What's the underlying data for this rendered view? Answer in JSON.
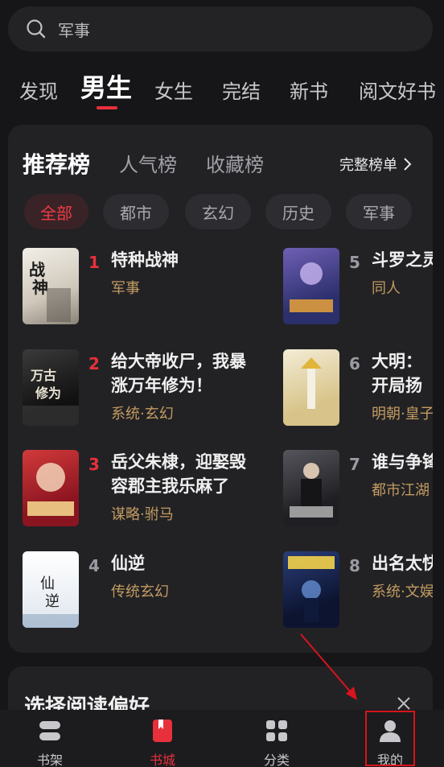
{
  "search": {
    "placeholder_value": "军事",
    "icon": "search-icon"
  },
  "tabs": [
    {
      "label": "发现",
      "active": false
    },
    {
      "label": "男生",
      "active": true
    },
    {
      "label": "女生",
      "active": false
    },
    {
      "label": "完结",
      "active": false
    },
    {
      "label": "新书",
      "active": false
    },
    {
      "label": "阅文好书",
      "active": false
    }
  ],
  "rank": {
    "tabs": [
      "推荐榜",
      "人气榜",
      "收藏榜"
    ],
    "active_tab": "推荐榜",
    "full_list_label": "完整榜单",
    "chips": [
      "全部",
      "都市",
      "玄幻",
      "历史",
      "军事"
    ],
    "active_chip": "全部",
    "books": [
      {
        "rank": "1",
        "title": "特种战神",
        "tag": "军事",
        "cover_color": "#d9d2c6"
      },
      {
        "rank": "2",
        "title": "给大帝收尸，我暴涨万年修为！",
        "tag": "系统·玄幻",
        "cover_color": "#2a2a2a"
      },
      {
        "rank": "3",
        "title": "岳父朱棣，迎娶毁容郡主我乐麻了",
        "tag": "谋略·驸马",
        "cover_color": "#b3202a"
      },
      {
        "rank": "4",
        "title": "仙逆",
        "tag": "传统玄幻",
        "cover_color": "#e9eef5"
      },
      {
        "rank": "5",
        "title": "斗罗之灵",
        "tag": "同人",
        "cover_color": "#4b4a8c"
      },
      {
        "rank": "6",
        "title": "大明：开局扬",
        "tag": "明朝·皇子",
        "cover_color": "#d9c38c"
      },
      {
        "rank": "7",
        "title": "谁与争锋",
        "tag": "都市江湖",
        "cover_color": "#3a3a40"
      },
      {
        "rank": "8",
        "title": "出名太快",
        "tag": "系统·文娱",
        "cover_color": "#1d2c56"
      }
    ]
  },
  "preference": {
    "title": "选择阅读偏好",
    "close_icon": "close-icon"
  },
  "bottom_nav": [
    {
      "label": "书架",
      "icon": "bookshelf-icon",
      "active": false
    },
    {
      "label": "书城",
      "icon": "bookstore-icon",
      "active": true
    },
    {
      "label": "分类",
      "icon": "category-grid-icon",
      "active": false
    },
    {
      "label": "我的",
      "icon": "profile-icon",
      "active": false
    }
  ],
  "colors": {
    "accent": "#e8303c",
    "tag": "#c39b61",
    "background": "#161618",
    "card": "#222225",
    "annotation": "#d8141c"
  }
}
